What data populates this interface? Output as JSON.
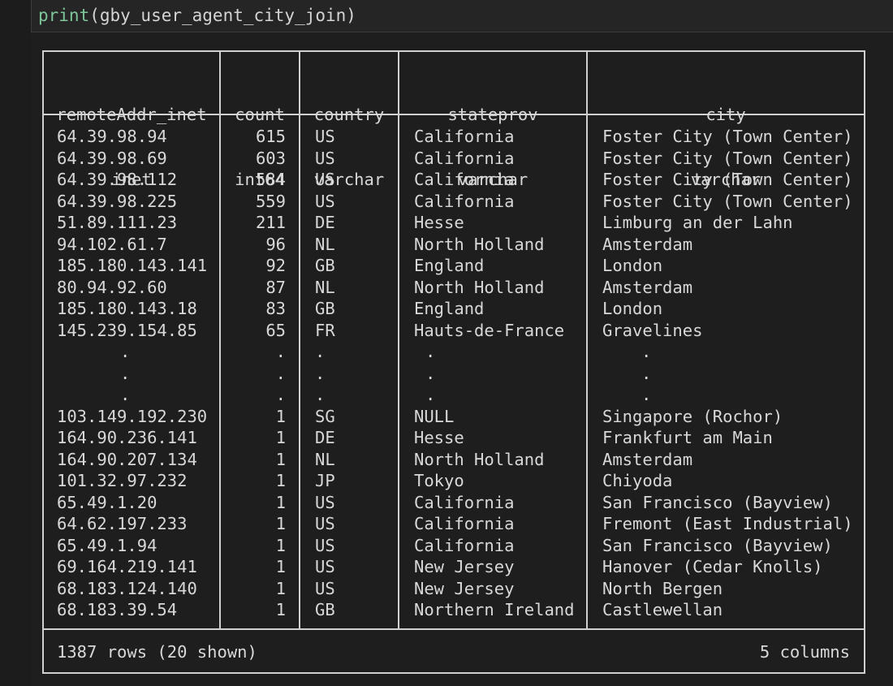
{
  "cell": {
    "code_func": "print",
    "code_arg": "(gby_user_agent_city_join)"
  },
  "table": {
    "columns": [
      {
        "name": "remoteAddr_inet",
        "type": "inet"
      },
      {
        "name": "count",
        "type": "int64"
      },
      {
        "name": "country",
        "type": "varchar"
      },
      {
        "name": "stateprov",
        "type": "varchar"
      },
      {
        "name": "city",
        "type": "varchar"
      }
    ],
    "rows": [
      [
        "64.39.98.94",
        "615",
        "US",
        "California",
        "Foster City (Town Center)"
      ],
      [
        "64.39.98.69",
        "603",
        "US",
        "California",
        "Foster City (Town Center)"
      ],
      [
        "64.39.98.112",
        "584",
        "US",
        "California",
        "Foster City (Town Center)"
      ],
      [
        "64.39.98.225",
        "559",
        "US",
        "California",
        "Foster City (Town Center)"
      ],
      [
        "51.89.111.23",
        "211",
        "DE",
        "Hesse",
        "Limburg an der Lahn"
      ],
      [
        "94.102.61.7",
        "96",
        "NL",
        "North Holland",
        "Amsterdam"
      ],
      [
        "185.180.143.141",
        "92",
        "GB",
        "England",
        "London"
      ],
      [
        "80.94.92.60",
        "87",
        "NL",
        "North Holland",
        "Amsterdam"
      ],
      [
        "185.180.143.18",
        "83",
        "GB",
        "England",
        "London"
      ],
      [
        "145.239.154.85",
        "65",
        "FR",
        "Hauts-de-France",
        "Gravelines"
      ],
      [
        ".",
        ".",
        ".",
        ".",
        "."
      ],
      [
        ".",
        ".",
        ".",
        ".",
        "."
      ],
      [
        ".",
        ".",
        ".",
        ".",
        "."
      ],
      [
        "103.149.192.230",
        "1",
        "SG",
        "NULL",
        "Singapore (Rochor)"
      ],
      [
        "164.90.236.141",
        "1",
        "DE",
        "Hesse",
        "Frankfurt am Main"
      ],
      [
        "164.90.207.134",
        "1",
        "NL",
        "North Holland",
        "Amsterdam"
      ],
      [
        "101.32.97.232",
        "1",
        "JP",
        "Tokyo",
        "Chiyoda"
      ],
      [
        "65.49.1.20",
        "1",
        "US",
        "California",
        "San Francisco (Bayview)"
      ],
      [
        "64.62.197.233",
        "1",
        "US",
        "California",
        "Fremont (East Industrial)"
      ],
      [
        "65.49.1.94",
        "1",
        "US",
        "California",
        "San Francisco (Bayview)"
      ],
      [
        "69.164.219.141",
        "1",
        "US",
        "New Jersey",
        "Hanover (Cedar Knolls)"
      ],
      [
        "68.183.124.140",
        "1",
        "US",
        "New Jersey",
        "North Bergen"
      ],
      [
        "68.183.39.54",
        "1",
        "GB",
        "Northern Ireland",
        "Castlewellan"
      ]
    ],
    "footer_rows": "1387 rows (20 shown)",
    "footer_cols": "5 columns"
  }
}
